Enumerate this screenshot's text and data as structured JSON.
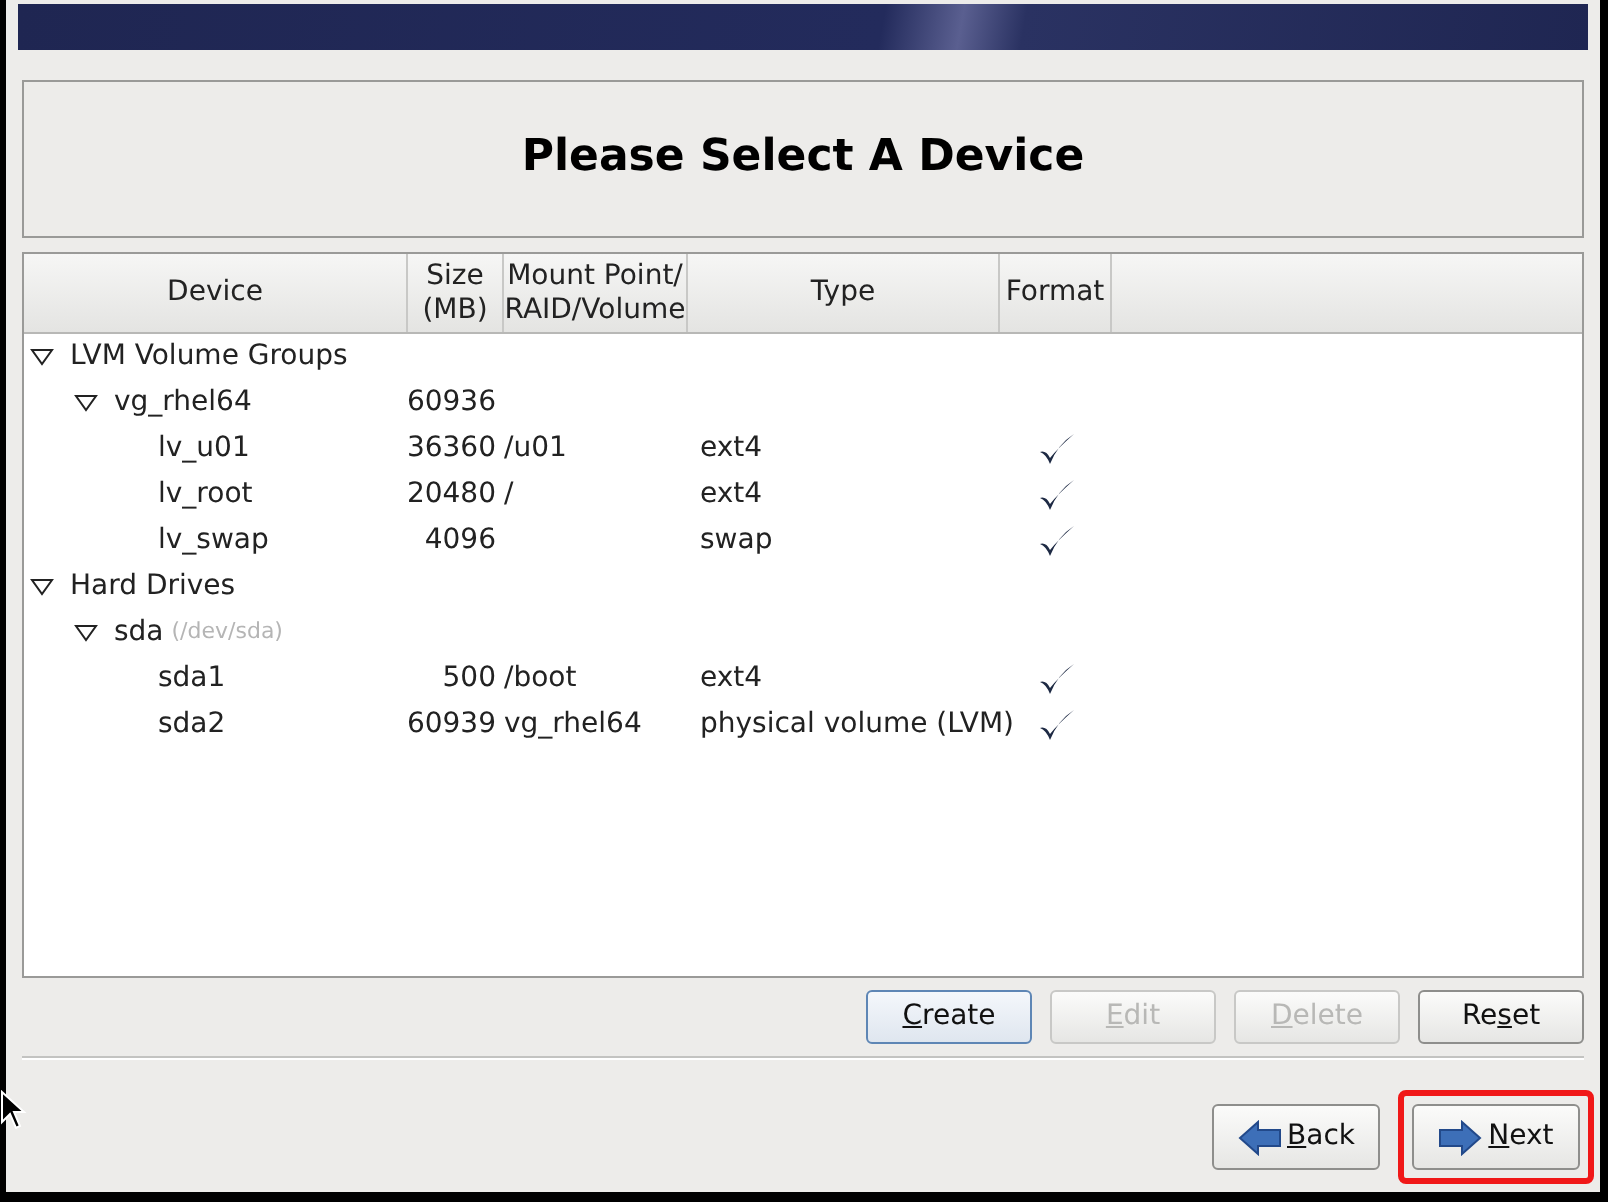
{
  "title": "Please Select A Device",
  "table": {
    "columns": [
      "Device",
      "Size\n(MB)",
      "Mount Point/\nRAID/Volume",
      "Type",
      "Format"
    ],
    "rows": [
      {
        "device": "LVM Volume Groups",
        "expanded": true,
        "children": [
          {
            "device": "vg_rhel64",
            "size": "60936",
            "expanded": true,
            "children": [
              {
                "device": "lv_u01",
                "size": "36360",
                "mount": "/u01",
                "type": "ext4",
                "format": true
              },
              {
                "device": "lv_root",
                "size": "20480",
                "mount": "/",
                "type": "ext4",
                "format": true
              },
              {
                "device": "lv_swap",
                "size": "4096",
                "type": "swap",
                "format": true
              }
            ]
          }
        ]
      },
      {
        "device": "Hard Drives",
        "expanded": true,
        "children": [
          {
            "device": "sda",
            "note": "(/dev/sda)",
            "expanded": true,
            "children": [
              {
                "device": "sda1",
                "size": "500",
                "mount": "/boot",
                "type": "ext4",
                "format": true
              },
              {
                "device": "sda2",
                "size": "60939",
                "mount": "vg_rhel64",
                "type": "physical volume (LVM)",
                "format": true
              }
            ]
          }
        ]
      }
    ]
  },
  "actions": [
    {
      "mnemonic": "C",
      "label_after": "reate",
      "disabled": false,
      "focused": true
    },
    {
      "mnemonic": "E",
      "label_after": "dit",
      "disabled": true,
      "focused": false
    },
    {
      "mnemonic": "D",
      "label_after": "elete",
      "disabled": true,
      "focused": false
    },
    {
      "label_before": "Re",
      "mnemonic": "s",
      "label_after": "et",
      "disabled": false,
      "focused": false
    }
  ],
  "navigation": [
    {
      "mnemonic": "B",
      "label_after": "ack",
      "kind": "back",
      "highlighted": false
    },
    {
      "mnemonic": "N",
      "label_after": "ext",
      "kind": "next",
      "highlighted": true
    }
  ]
}
